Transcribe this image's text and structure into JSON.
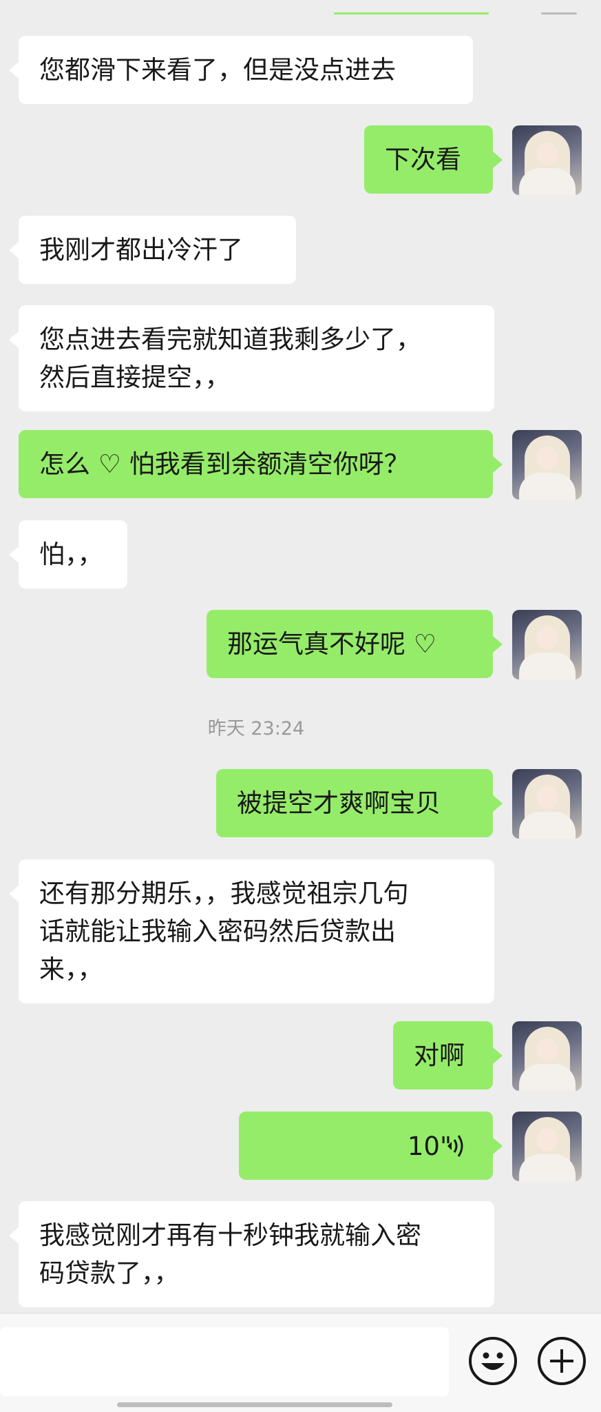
{
  "messages": [
    {
      "side": "in",
      "text": "您都滑下来看了，但是没点进去"
    },
    {
      "side": "out",
      "text": "下次看"
    },
    {
      "side": "in",
      "text": "我刚才都出冷汗了"
    },
    {
      "side": "in",
      "text": "您点进去看完就知道我剩多少了，\n然后直接提空，，"
    },
    {
      "side": "out",
      "text": "怎么 ♡ 怕我看到余额清空你呀？"
    },
    {
      "side": "in",
      "text": "怕，，"
    },
    {
      "side": "out",
      "text": "那运气真不好呢 ♡"
    },
    {
      "side": "out",
      "text": "被提空才爽啊宝贝"
    },
    {
      "side": "in",
      "text": "还有那分期乐，，我感觉祖宗几句\n话就能让我输入密码然后贷款出\n来，，"
    },
    {
      "side": "out",
      "text": "对啊"
    },
    {
      "side": "in",
      "text": "我感觉刚才再有十秒钟我就输入密\n码贷款了，，"
    }
  ],
  "timestamp": "昨天 23:24",
  "voice_message": {
    "duration": "10\""
  },
  "colors": {
    "outgoing_bubble": "#95ec69",
    "incoming_bubble": "#ffffff",
    "background": "#ededed"
  },
  "input_bar": {
    "emoji_icon": "emoji-icon",
    "plus_icon": "plus-icon"
  }
}
